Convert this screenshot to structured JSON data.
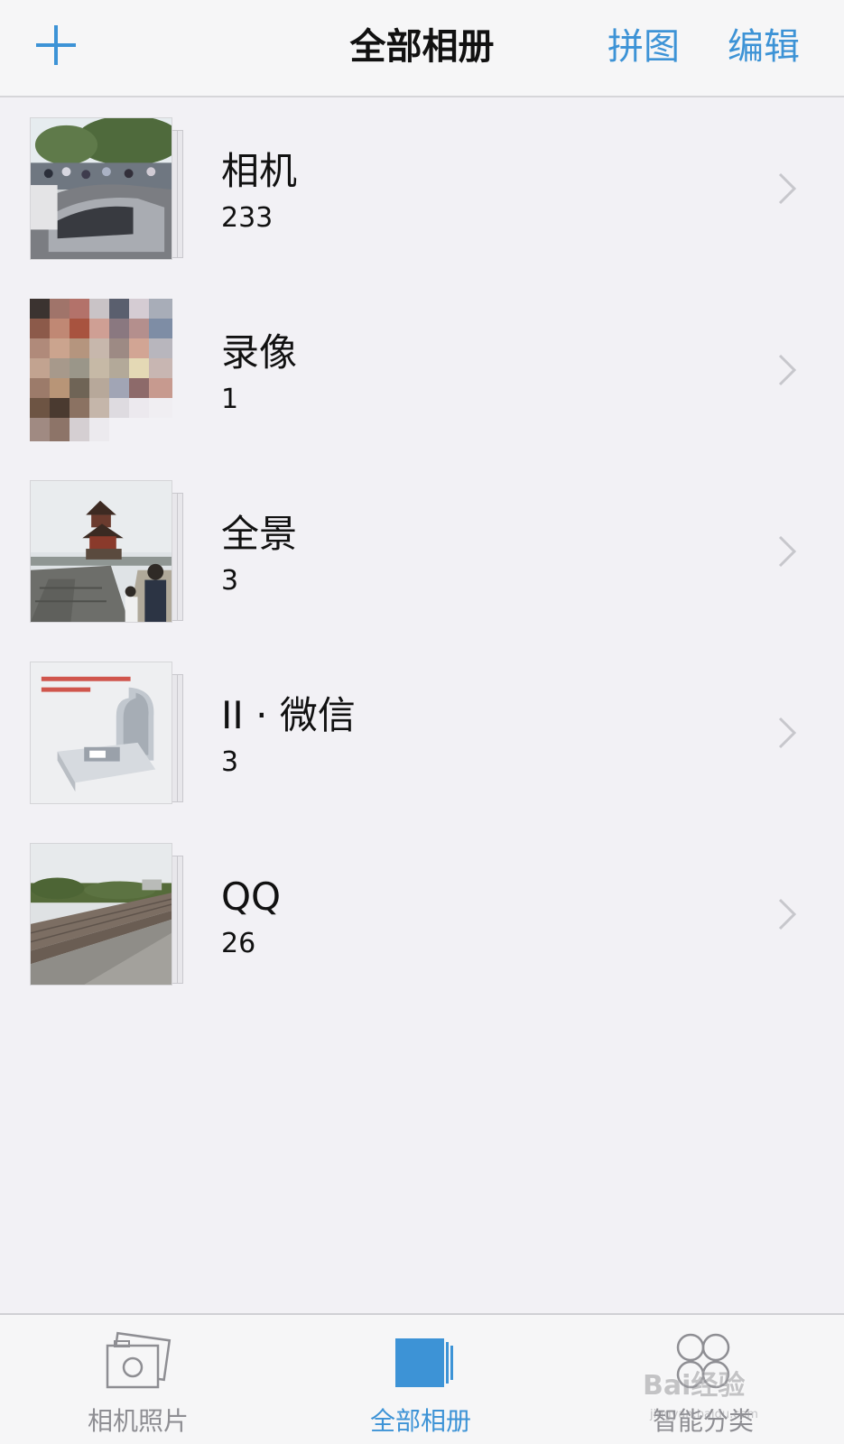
{
  "header": {
    "title": "全部相册",
    "add_icon": "plus-icon",
    "collage_label": "拼图",
    "edit_label": "编辑",
    "accent_color": "#3d93d6"
  },
  "albums": [
    {
      "name": "相机",
      "count": "233",
      "thumbnail": "street-cars-photo"
    },
    {
      "name": "录像",
      "count": "1",
      "thumbnail": "pixelated-video-frame"
    },
    {
      "name": "全景",
      "count": "3",
      "thumbnail": "tower-gate-photo"
    },
    {
      "name": "II · 微信",
      "count": "3",
      "thumbnail": "device-product-photo"
    },
    {
      "name": "QQ",
      "count": "26",
      "thumbnail": "city-wall-photo"
    }
  ],
  "tabs": [
    {
      "label": "相机照片",
      "icon": "camera-photos-icon",
      "active": false
    },
    {
      "label": "全部相册",
      "icon": "albums-icon",
      "active": true
    },
    {
      "label": "智能分类",
      "icon": "smart-category-icon",
      "active": false
    }
  ],
  "watermark": {
    "brand": "Bai经验",
    "sub": "jingyan.baidu.com"
  }
}
